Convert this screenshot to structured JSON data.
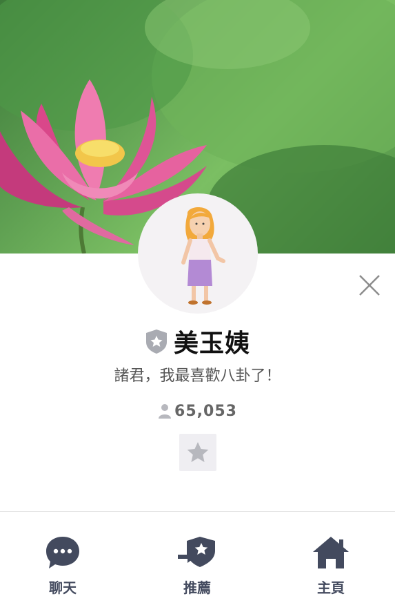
{
  "profile": {
    "name": "美玉姨",
    "status_message": "諸君，我最喜歡八卦了！",
    "friend_count": "65,053"
  },
  "icons": {
    "close": "close-icon",
    "badge": "shield-star-icon",
    "friends": "person-icon",
    "favorite": "star-icon"
  },
  "actions": [
    {
      "label": "聊天",
      "icon": "chat-bubble-icon"
    },
    {
      "label": "推薦",
      "icon": "recommend-icon"
    },
    {
      "label": "主頁",
      "icon": "home-icon"
    }
  ],
  "colors": {
    "action_icon": "#434a5e",
    "badge": "#a9abb2",
    "star": "#b7b8be"
  }
}
